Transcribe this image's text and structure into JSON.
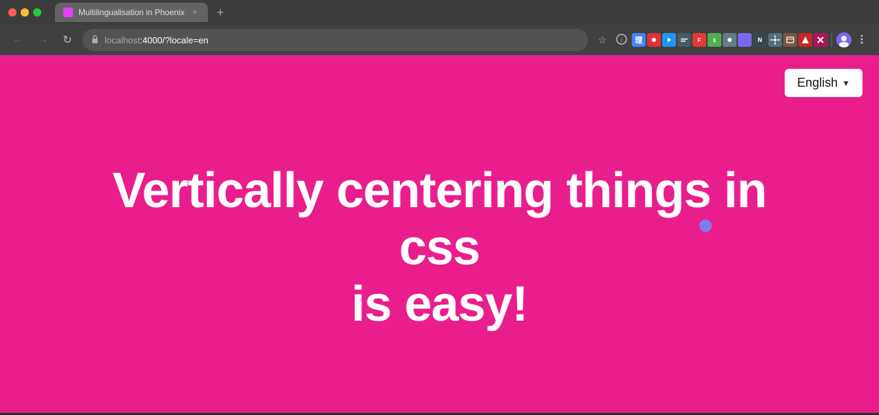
{
  "browser": {
    "tab": {
      "favicon_label": "phoenix",
      "title": "Multilingualisation in Phoenix",
      "close_label": "×"
    },
    "new_tab_label": "+",
    "nav": {
      "back_label": "←",
      "forward_label": "→",
      "reload_label": "↻"
    },
    "address_bar": {
      "url_prefix": "localhost",
      "url_path": ":4000/?locale=en",
      "lock_icon": "🔒"
    },
    "bookmark_icon": "☆",
    "info_icon": "ℹ",
    "menu_icon": "⋮"
  },
  "page": {
    "locale_button": {
      "label": "English",
      "chevron": "▼"
    },
    "hero_line1": "Vertically centering things in css",
    "hero_line2": "is easy!"
  }
}
